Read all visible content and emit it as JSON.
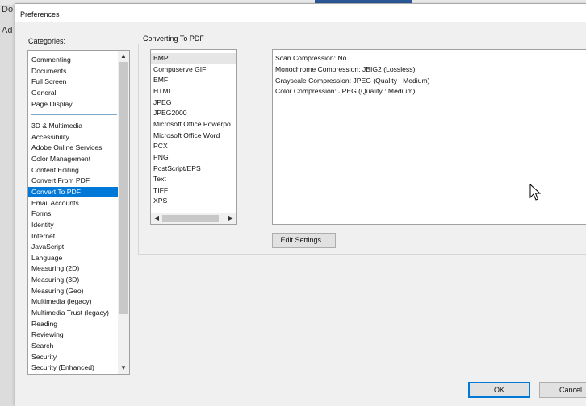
{
  "background": {
    "left_text_top": "Do",
    "left_text_bottom": "Ad"
  },
  "window": {
    "title": "Preferences"
  },
  "categories": {
    "label": "Categories:",
    "group1": [
      "Commenting",
      "Documents",
      "Full Screen",
      "General",
      "Page Display"
    ],
    "group2": [
      "3D & Multimedia",
      "Accessibility",
      "Adobe Online Services",
      "Color Management",
      "Content Editing",
      "Convert From PDF",
      "Convert To PDF",
      "Email Accounts",
      "Forms",
      "Identity",
      "Internet",
      "JavaScript",
      "Language",
      "Measuring (2D)",
      "Measuring (3D)",
      "Measuring (Geo)",
      "Multimedia (legacy)",
      "Multimedia Trust (legacy)",
      "Reading",
      "Reviewing",
      "Search",
      "Security",
      "Security (Enhanced)"
    ],
    "selected": "Convert To PDF"
  },
  "converting": {
    "label": "Converting To PDF",
    "formats": [
      "BMP",
      "Compuserve GIF",
      "EMF",
      "HTML",
      "JPEG",
      "JPEG2000",
      "Microsoft Office Powerpo",
      "Microsoft Office Word",
      "PCX",
      "PNG",
      "PostScript/EPS",
      "Text",
      "TIFF",
      "XPS"
    ],
    "selected_format": "BMP",
    "settings": [
      "Scan Compression: No",
      "Monochrome Compression: JBIG2 (Lossless)",
      "Grayscale Compression: JPEG (Quality : Medium)",
      "Color Compression: JPEG (Quality : Medium)"
    ],
    "edit_button": "Edit Settings..."
  },
  "footer": {
    "ok_label": "OK",
    "cancel_label": "Cancel"
  },
  "colors": {
    "selection": "#0078d7",
    "accent_border": "#0078d7"
  }
}
